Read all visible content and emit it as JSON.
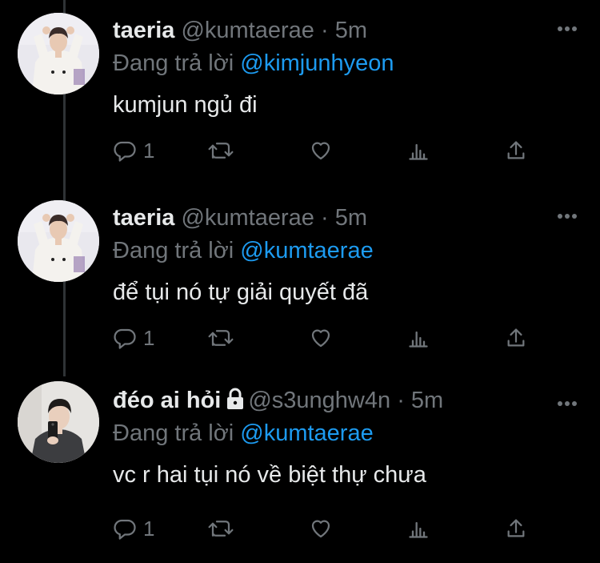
{
  "tweets": [
    {
      "name": "taeria",
      "handle": "@kumtaerae",
      "dot": "·",
      "time": "5m",
      "reply_prefix": "Đang trả lời",
      "reply_to": "@kimjunhyeon",
      "text": "kumjun ngủ đi",
      "reply_count": "1",
      "locked": false,
      "avatar": "avatar-photo-person-white-outfit"
    },
    {
      "name": "taeria",
      "handle": "@kumtaerae",
      "dot": "·",
      "time": "5m",
      "reply_prefix": "Đang trả lời",
      "reply_to": "@kumtaerae",
      "text": "để tụi nó tự giải quyết đã",
      "reply_count": "1",
      "locked": false,
      "avatar": "avatar-photo-person-white-outfit"
    },
    {
      "name": "đéo ai hỏi",
      "handle": "@s3unghw4n",
      "dot": "·",
      "time": "5m",
      "reply_prefix": "Đang trả lời",
      "reply_to": "@kumtaerae",
      "text": "vc r hai tụi nó về biệt thự chưa",
      "reply_count": "1",
      "locked": true,
      "avatar": "avatar-photo-person-mirror-selfie"
    }
  ],
  "icons": {
    "reply": "reply-icon",
    "retweet": "retweet-icon",
    "like": "heart-icon",
    "analytics": "analytics-icon",
    "share": "share-icon",
    "more": "more-icon",
    "lock": "lock-icon"
  },
  "colors": {
    "background": "#000000",
    "text": "#e7e9ea",
    "secondary": "#71767b",
    "link": "#1d9bf0",
    "thread_line": "#2f3336"
  }
}
